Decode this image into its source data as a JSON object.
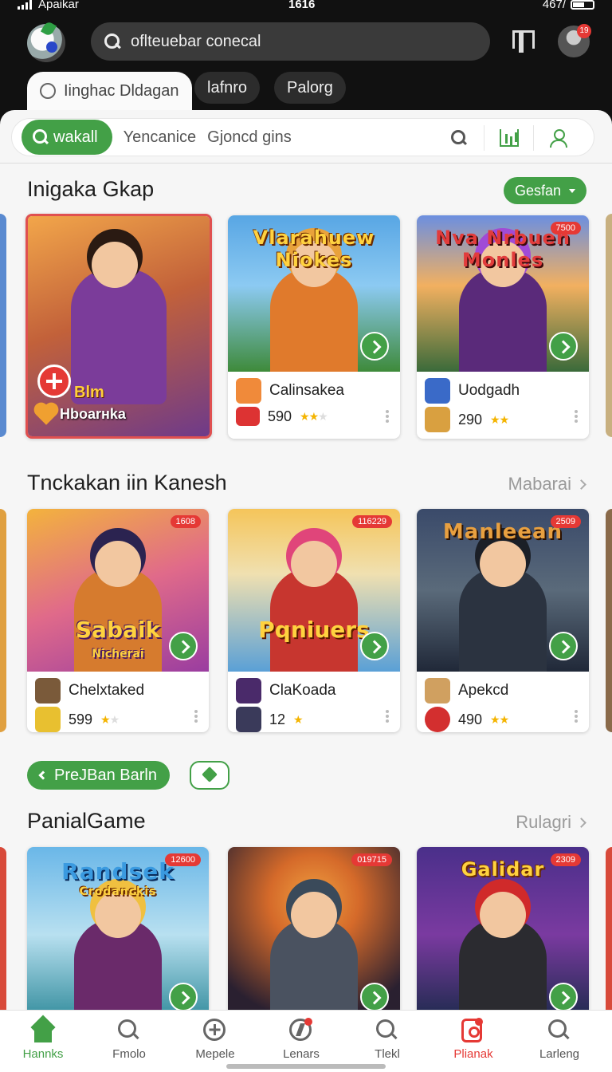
{
  "status": {
    "carrier": "Apaikar",
    "time": "1616",
    "battery": "467/"
  },
  "search": {
    "placeholder": "ofltеuebar conecal"
  },
  "top_tabs": [
    {
      "label": "Iinghac Dldagan",
      "active": true
    },
    {
      "label": "lafnro",
      "active": false
    },
    {
      "label": "Palorg",
      "active": false
    }
  ],
  "avatar_badge": "19",
  "filters": {
    "active": "wakall",
    "chips": [
      "Yencanice",
      "Gjoncd gins"
    ]
  },
  "sections": [
    {
      "title": "Inigaka Gkap",
      "action": "Gesfan",
      "cards": [
        {
          "featured": true,
          "badge_title": "Blm",
          "subtitle": "Hboarнka",
          "colors": [
            "#e98a3a",
            "#7a3d8f"
          ],
          "hair": "#2a1a12",
          "shirt": "#7b3c9a"
        },
        {
          "title": "Vlarahuew Niokes",
          "name": "Calinsakea",
          "rating": "590",
          "colors": [
            "#58a6e4",
            "#3e8a3a"
          ],
          "hair": "#e9a23b",
          "shirt": "#e07a2c"
        },
        {
          "title": "Nva Nrbuen Monles",
          "price": "7500",
          "name": "Uodgadh",
          "rating": "290",
          "colors": [
            "#6c8fe0",
            "#3a6a3a"
          ],
          "hair": "#a04bd6",
          "shirt": "#5a2a7a"
        }
      ]
    },
    {
      "title": "Tnckakan iin Kanesh",
      "action": "Mabarai",
      "cards": [
        {
          "title": "Sabaik",
          "subtitle_art": "Nicherai",
          "price": "1608",
          "name": "Chelxtaked",
          "rating": "599",
          "colors": [
            "#f3b33d",
            "#9a3da0"
          ],
          "hair": "#2b2350",
          "shirt": "#d67b2e"
        },
        {
          "title": "Pqniuers",
          "price": "116229",
          "name": "ClaKoada",
          "rating": "12",
          "colors": [
            "#f5c55a",
            "#5aa0d6"
          ],
          "hair": "#e0457a",
          "shirt": "#c7362f"
        },
        {
          "title": "Manleean",
          "price": "2509",
          "name": "Apekcd",
          "rating": "490",
          "colors": [
            "#3a4a6a",
            "#202838"
          ],
          "hair": "#1b1f27",
          "shirt": "#2b3340"
        }
      ]
    },
    {
      "title": "PanialGame",
      "action": "Rulagri",
      "cta": "PreJBan Barln",
      "cards": [
        {
          "title": "Randsek",
          "subtitle_art": "Crodanckis",
          "price": "12600",
          "colors": [
            "#6ab7e8",
            "#2f8a9a"
          ],
          "hair": "#f0c040",
          "shirt": "#6a2a6a"
        },
        {
          "title": "",
          "price": "019715",
          "colors": [
            "#d56a2a",
            "#2a2030"
          ],
          "hair": "#3a4a5a",
          "shirt": "#4a5260"
        },
        {
          "title": "Galidar",
          "price": "2309",
          "colors": [
            "#4a2f8a",
            "#1a2a4a"
          ],
          "hair": "#d02a2a",
          "shirt": "#2b2b30"
        }
      ]
    }
  ],
  "bottom_nav": [
    {
      "label": "Hannks",
      "icon": "home-icon",
      "state": "active"
    },
    {
      "label": "Fmolo",
      "icon": "search-icon",
      "state": ""
    },
    {
      "label": "Mepele",
      "icon": "plus-circle-icon",
      "state": ""
    },
    {
      "label": "Lenars",
      "icon": "bolt-icon",
      "state": "badge"
    },
    {
      "label": "Tlekl",
      "icon": "search-icon",
      "state": ""
    },
    {
      "label": "Plianak",
      "icon": "bag-icon",
      "state": "red"
    },
    {
      "label": "Larleng",
      "icon": "search-icon",
      "state": ""
    }
  ],
  "colors": {
    "accent": "#43a047",
    "badge": "#e53935",
    "top_bg": "#111111",
    "panel_bg": "#f6f6f6"
  }
}
